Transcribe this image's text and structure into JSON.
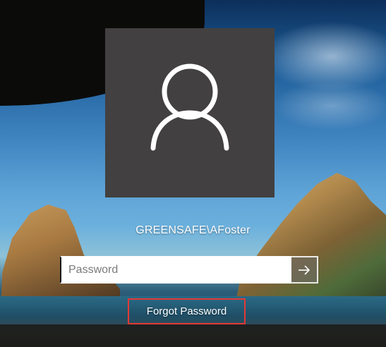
{
  "login": {
    "username": "GREENSAFE\\AFoster",
    "password_placeholder": "Password",
    "password_value": "",
    "forgot_password_label": "Forgot Password"
  },
  "icons": {
    "avatar": "user-silhouette-icon",
    "submit": "arrow-right-icon"
  },
  "colors": {
    "avatar_tile": "#424040",
    "highlight_box": "#e53935",
    "text": "#ffffff"
  }
}
